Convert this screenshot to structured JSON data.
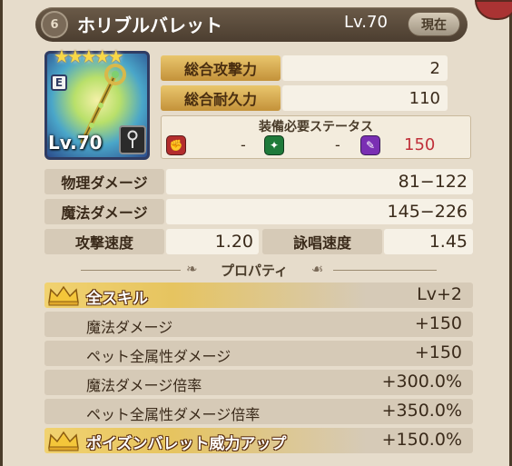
{
  "header": {
    "title": "ホリブルバレット",
    "level": "Lv.70",
    "current_label": "現在"
  },
  "item": {
    "grade": "E",
    "level": "Lv.70",
    "stars": "★★★★★"
  },
  "stats_top": [
    {
      "label": "総合攻撃力",
      "value": "2"
    },
    {
      "label": "総合耐久力",
      "value": "110"
    }
  ],
  "requirements": {
    "title": "装備必要ステータス",
    "str": "-",
    "dex": "-",
    "int": "150",
    "int_color": "#c0303a"
  },
  "damage": [
    {
      "label": "物理ダメージ",
      "value": "81−122"
    },
    {
      "label": "魔法ダメージ",
      "value": "145−226"
    }
  ],
  "speeds": {
    "attack_label": "攻撃速度",
    "attack_value": "1.20",
    "cast_label": "詠唱速度",
    "cast_value": "1.45"
  },
  "properties_title": "プロパティ",
  "properties": [
    {
      "name": "全スキル",
      "value": "Lv+2"
    },
    {
      "name": "魔法ダメージ",
      "value": "+150"
    },
    {
      "name": "ペット全属性ダメージ",
      "value": "+150"
    },
    {
      "name": "魔法ダメージ倍率",
      "value": "+300.0%"
    },
    {
      "name": "ペット全属性ダメージ倍率",
      "value": "+350.0%"
    },
    {
      "name": "ポイズンバレット威力アップ",
      "value": "+150.0%"
    }
  ]
}
